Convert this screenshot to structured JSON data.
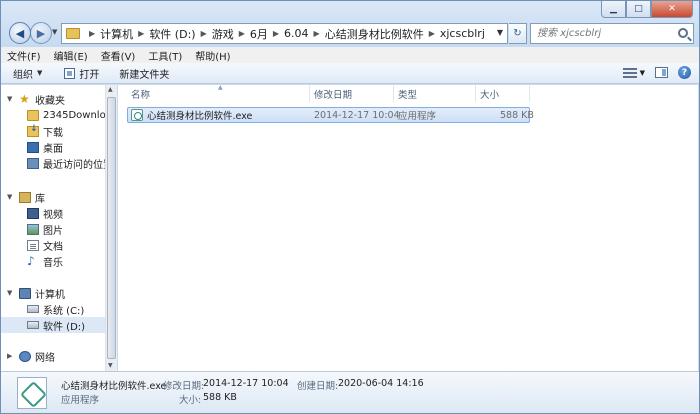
{
  "window": {
    "caption": {
      "minimize": "▁",
      "maximize": "□",
      "close": "✕"
    }
  },
  "address": {
    "crumbs": [
      "计算机",
      "软件 (D:)",
      "游戏",
      "6月",
      "6.04",
      "心结测身材比例软件",
      "xjcscblrj"
    ]
  },
  "search": {
    "placeholder": "搜索 xjcscblrj"
  },
  "menu": {
    "file": "文件(F)",
    "edit": "编辑(E)",
    "view": "查看(V)",
    "tools": "工具(T)",
    "help": "帮助(H)"
  },
  "toolbar": {
    "organize": "组织",
    "open": "打开",
    "new_folder": "新建文件夹"
  },
  "sidebar": {
    "favorites": {
      "label": "收藏夹",
      "items": [
        "2345Downloads",
        "下载",
        "桌面",
        "最近访问的位置"
      ]
    },
    "libraries": {
      "label": "库",
      "items": [
        "视频",
        "图片",
        "文档",
        "音乐"
      ]
    },
    "computer": {
      "label": "计算机",
      "items": [
        "系统 (C:)",
        "软件 (D:)"
      ]
    },
    "network": {
      "label": "网络"
    }
  },
  "columns": {
    "name": "名称",
    "modified": "修改日期",
    "type": "类型",
    "size": "大小"
  },
  "files": [
    {
      "name": "心结测身材比例软件.exe",
      "modified": "2014-12-17 10:04",
      "type": "应用程序",
      "size": "588 KB"
    }
  ],
  "details": {
    "filename": "心结测身材比例软件.exe",
    "modified_label": "修改日期:",
    "modified_value": "2014-12-17 10:04",
    "created_label": "创建日期:",
    "created_value": "2020-06-04 14:16",
    "type": "应用程序",
    "size_label": "大小:",
    "size_value": "588 KB"
  },
  "colors": {
    "selection": "#cde0f7",
    "window_frame": "#c9dcf1"
  }
}
